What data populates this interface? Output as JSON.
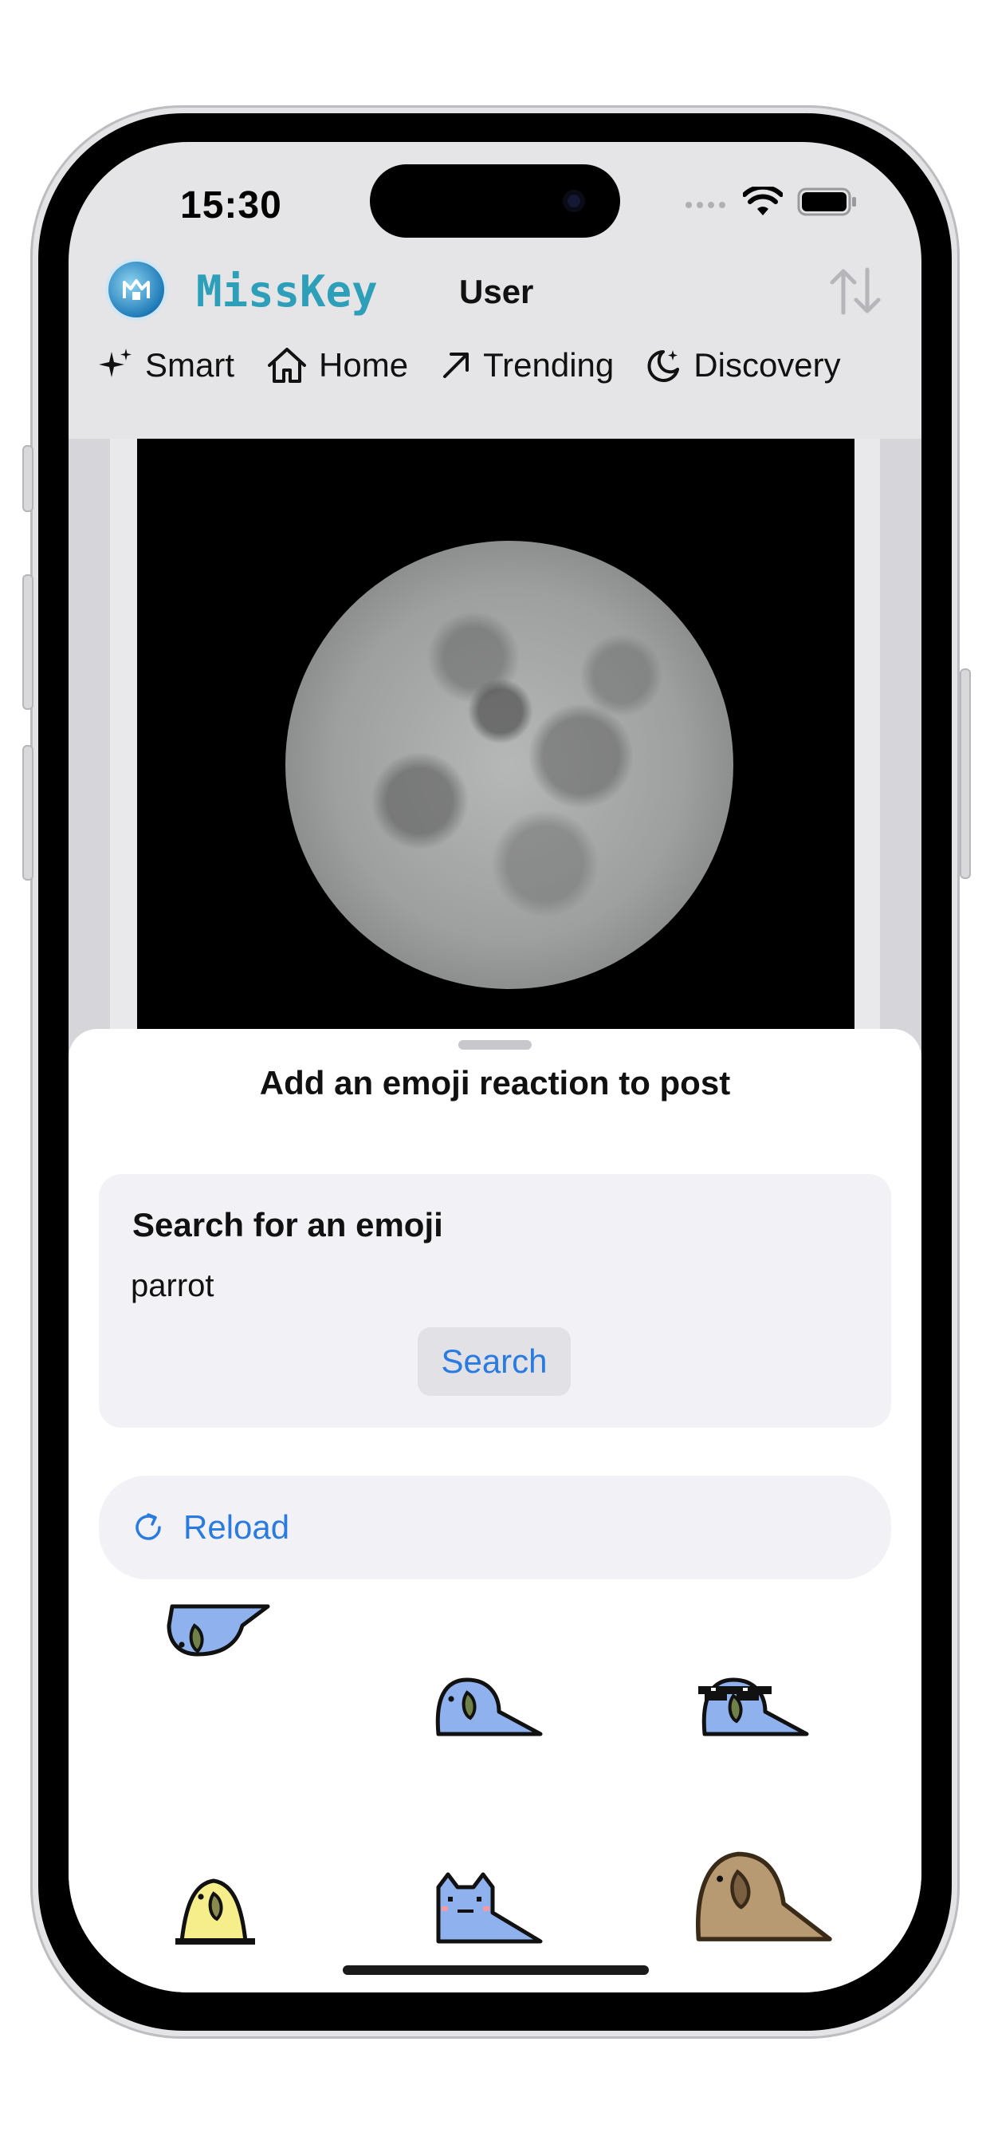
{
  "status_bar": {
    "time": "15:30"
  },
  "header": {
    "brand": "MissKey",
    "account": "User"
  },
  "tabs": [
    {
      "label": "Smart",
      "icon": "sparkle-icon"
    },
    {
      "label": "Home",
      "icon": "house-icon"
    },
    {
      "label": "Trending",
      "icon": "arrow-up-right-icon"
    },
    {
      "label": "Discovery",
      "icon": "moon-stars-icon"
    }
  ],
  "post": {
    "image": "full-moon-image"
  },
  "sheet": {
    "title": "Add an emoji reaction to post",
    "search": {
      "label": "Search for an emoji",
      "value": "parrot",
      "button": "Search"
    },
    "reload": {
      "label": "Reload"
    },
    "emojis": [
      "parrot-upside-down-emoji",
      "parrot-emoji",
      "parrot-sunglasses-emoji",
      "parrot-yellow-emoji",
      "parrot-cat-emoji",
      "parrot-brown-emoji"
    ]
  },
  "colors": {
    "accent": "#2a7be0",
    "brand": "#2e9fb9",
    "parrot_blue": "#8fb2ef",
    "parrot_yellow": "#f5ee8a",
    "parrot_brown": "#b89a72"
  }
}
